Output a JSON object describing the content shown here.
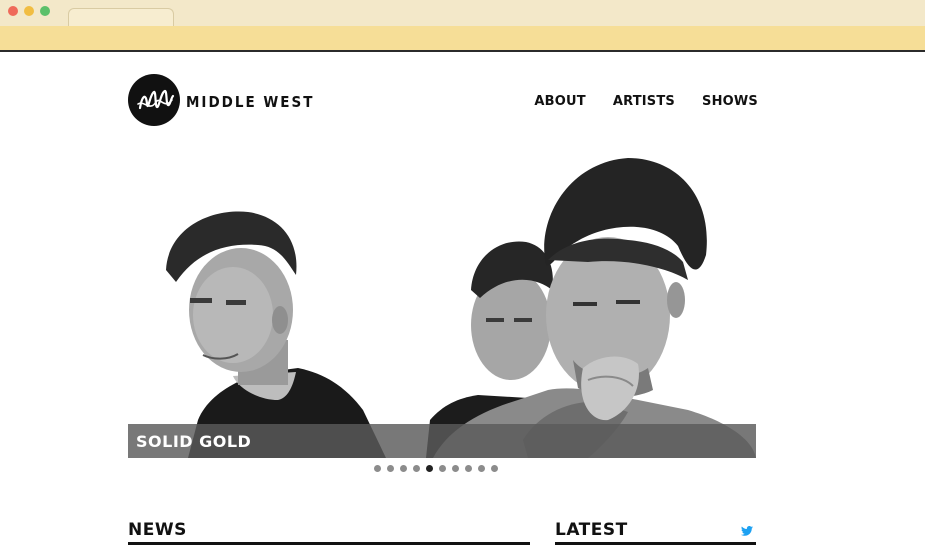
{
  "browser": {
    "tab_title": ""
  },
  "header": {
    "brand": "MIDDLE WEST",
    "nav": [
      {
        "label": "ABOUT"
      },
      {
        "label": "ARTISTS"
      },
      {
        "label": "SHOWS"
      }
    ]
  },
  "hero": {
    "caption": "SOLID GOLD",
    "slides_count": 10,
    "active_slide": 5
  },
  "sections": {
    "news_title": "NEWS",
    "latest_title": "LATEST",
    "latest_icon": "twitter-icon"
  },
  "colors": {
    "chrome_top": "#f3e8c9",
    "chrome_bar": "#f6de97",
    "accent_twitter": "#1da1f2",
    "text": "#111111"
  }
}
